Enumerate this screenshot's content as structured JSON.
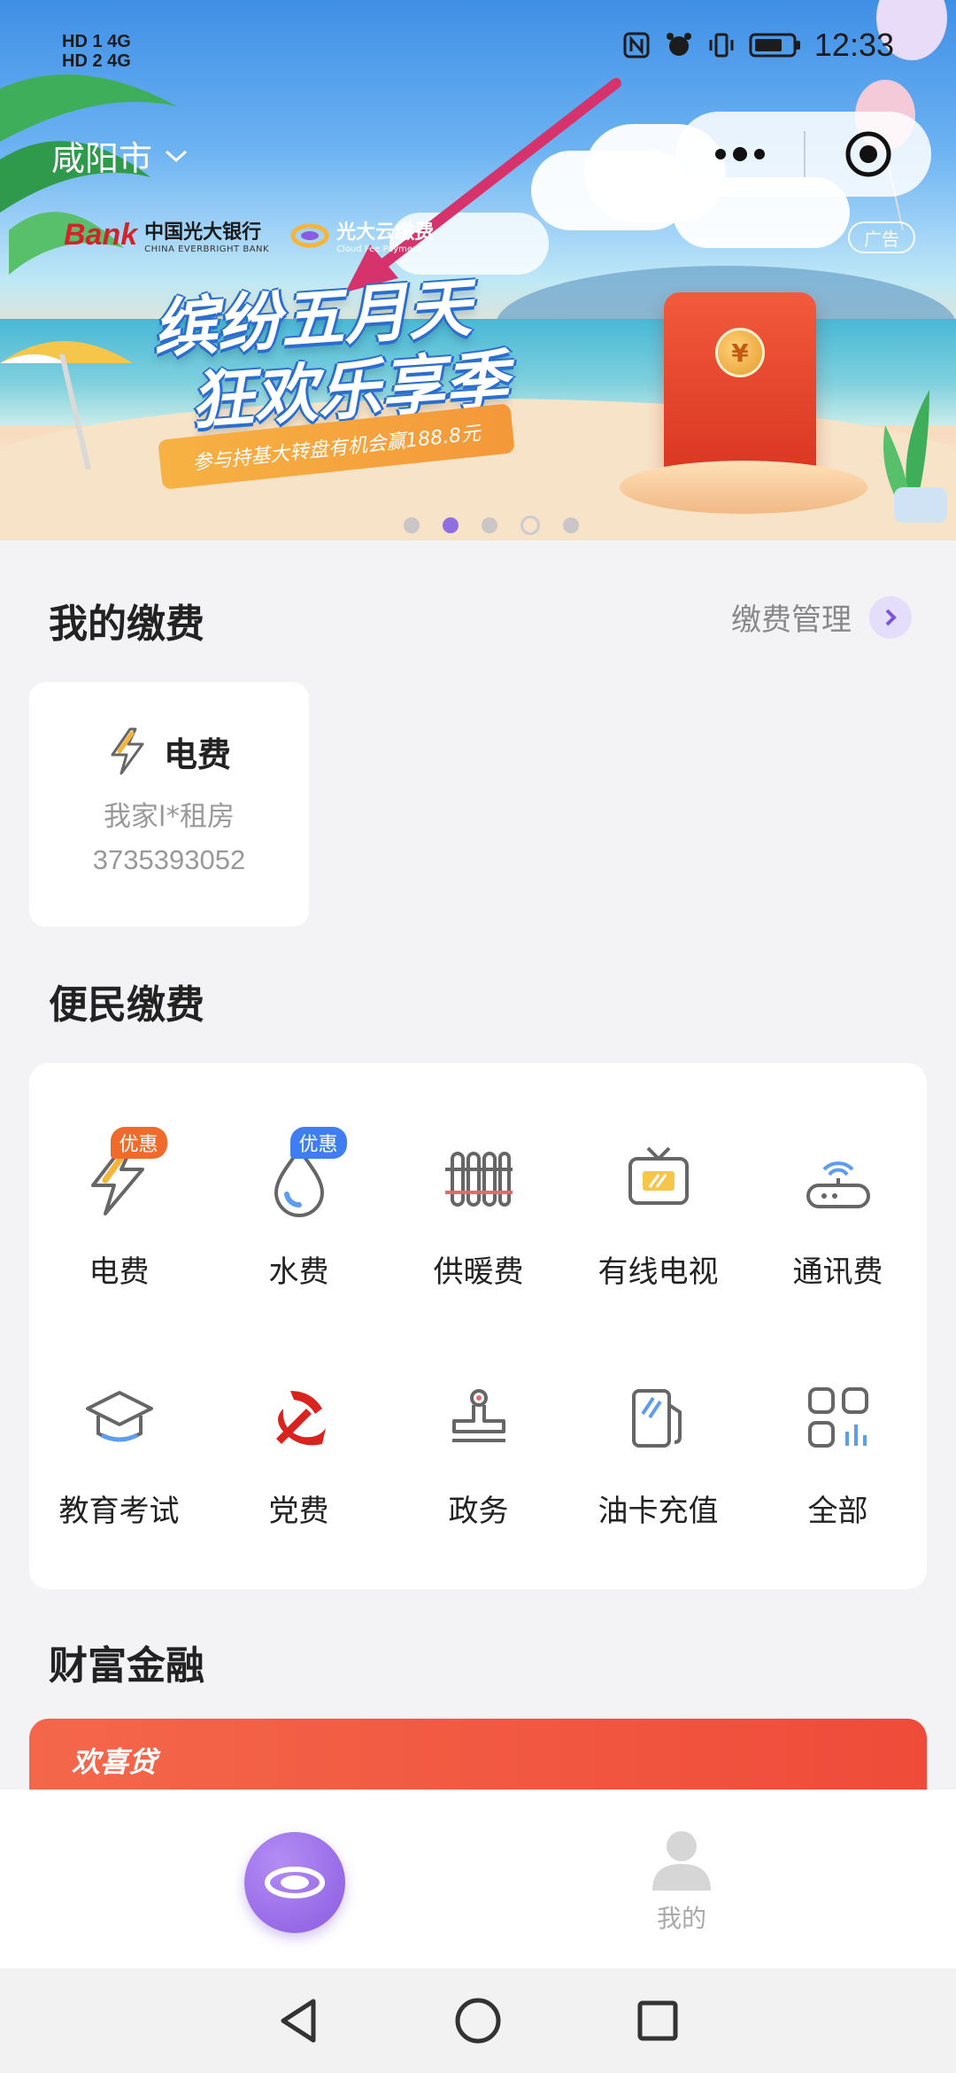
{
  "status_bar": {
    "time": "12:33",
    "left_line1": "HD 1  4G",
    "left_line2": "HD 2  4G"
  },
  "banner": {
    "city": "咸阳市",
    "bank_logo": "Bank",
    "bank_name_cn": "中国光大银行",
    "bank_name_en": "CHINA EVERBRIGHT BANK",
    "cloud_name_cn": "光大云缴费",
    "cloud_name_en": "Cloud Fee Payment",
    "ad_tag": "广告",
    "promo_line1": "缤纷五月天",
    "promo_line2": "狂欢乐享季",
    "promo_ribbon": "参与持基大转盘有机会赢188.8元",
    "coin_symbol": "¥",
    "carousel_active_index": 1,
    "carousel_count": 5
  },
  "my_payments": {
    "title": "我的缴费",
    "manage_label": "缴费管理",
    "card": {
      "title": "电费",
      "account_name": "我家l*租房",
      "account_number": "3735393052"
    }
  },
  "convenience": {
    "title": "便民缴费",
    "items": [
      {
        "label": "电费",
        "icon": "lightning-icon",
        "badge": "优惠",
        "badge_color": "#f06b2b"
      },
      {
        "label": "水费",
        "icon": "water-drop-icon",
        "badge": "优惠",
        "badge_color": "#3f7ef2"
      },
      {
        "label": "供暖费",
        "icon": "radiator-icon"
      },
      {
        "label": "有线电视",
        "icon": "tv-icon"
      },
      {
        "label": "通讯费",
        "icon": "router-icon"
      },
      {
        "label": "教育考试",
        "icon": "graduation-cap-icon"
      },
      {
        "label": "党费",
        "icon": "party-emblem-icon"
      },
      {
        "label": "政务",
        "icon": "stamp-icon"
      },
      {
        "label": "油卡充值",
        "icon": "fuel-pump-icon"
      },
      {
        "label": "全部",
        "icon": "all-grid-icon"
      }
    ]
  },
  "finance": {
    "title": "财富金融",
    "banner_text": "欢喜贷"
  },
  "tabbar": {
    "home_icon": "planet-icon",
    "mine_label": "我的"
  },
  "colors": {
    "accent": "#8a5ce0",
    "badge_orange": "#f06b2b",
    "badge_blue": "#3f7ef2",
    "page_bg": "#f3f3f6"
  }
}
